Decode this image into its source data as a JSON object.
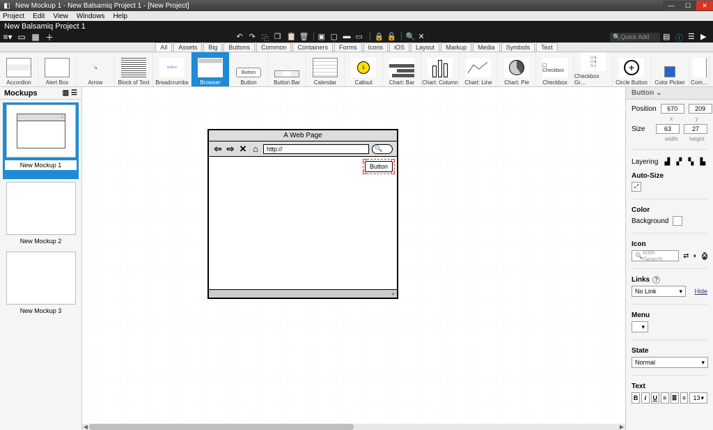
{
  "titlebar": {
    "title": "New Mockup 1 - New Balsamiq Project 1 - [New Project]"
  },
  "menubar": [
    "Project",
    "Edit",
    "View",
    "Windows",
    "Help"
  ],
  "projectbar": {
    "title": "New Balsamiq Project 1"
  },
  "quick_add": {
    "placeholder": "Quick Add"
  },
  "tabs": [
    "All",
    "Assets",
    "Big",
    "Buttons",
    "Common",
    "Containers",
    "Forms",
    "Icons",
    "iOS",
    "Layout",
    "Markup",
    "Media",
    "Symbols",
    "Text"
  ],
  "active_tab": "All",
  "library": [
    {
      "name": "Accordion"
    },
    {
      "name": "Alert Box"
    },
    {
      "name": "Arrow"
    },
    {
      "name": "Block of Text"
    },
    {
      "name": "Breadcrumbs"
    },
    {
      "name": "Browser"
    },
    {
      "name": "Button"
    },
    {
      "name": "Button Bar"
    },
    {
      "name": "Calendar"
    },
    {
      "name": "Callout"
    },
    {
      "name": "Chart: Bar"
    },
    {
      "name": "Chart: Column"
    },
    {
      "name": "Chart: Line"
    },
    {
      "name": "Chart: Pie"
    },
    {
      "name": "Checkbox"
    },
    {
      "name": "Checkbox Gr…"
    },
    {
      "name": "Circle Button"
    },
    {
      "name": "Color Picker"
    },
    {
      "name": "Com…"
    }
  ],
  "library_selected": 5,
  "mockups": {
    "header": "Mockups",
    "items": [
      "New Mockup 1",
      "New Mockup 2",
      "New Mockup 3"
    ],
    "selected": 0
  },
  "canvas": {
    "browser_title": "A Web Page",
    "url_value": "http://",
    "button_label": "Button"
  },
  "props": {
    "header": "Button",
    "labels": {
      "position": "Position",
      "x": "x",
      "y": "y",
      "size": "Size",
      "width": "width",
      "height": "height",
      "layering": "Layering",
      "autosize": "Auto-Size",
      "color": "Color",
      "background": "Background",
      "icon": "Icon",
      "icon_placeholder": "Icon Search",
      "links": "Links",
      "links_help": "?",
      "hide": "Hide",
      "menu": "Menu",
      "state": "State",
      "text": "Text"
    },
    "position": {
      "x": "670",
      "y": "209"
    },
    "size": {
      "w": "63",
      "h": "27"
    },
    "links_value": "No Link",
    "state_value": "Normal",
    "font_size": "13"
  }
}
